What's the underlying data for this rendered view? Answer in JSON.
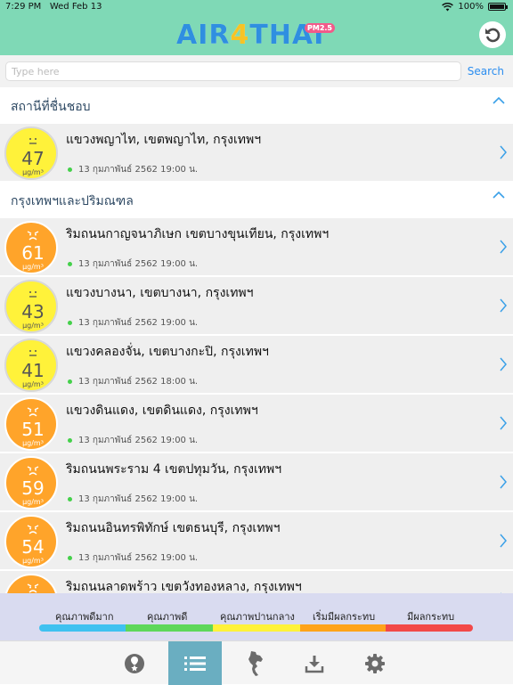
{
  "status_bar": {
    "time": "7:29 PM",
    "date": "Wed Feb 13",
    "battery": "100%",
    "battery_level": 1.0
  },
  "header": {
    "logo_air": "AIR",
    "logo_4": "4",
    "logo_thai": "THAI",
    "logo_badge": "PM2.5"
  },
  "search": {
    "placeholder": "Type here",
    "button": "Search"
  },
  "sections": [
    {
      "title": "สถานีที่ชื่นชอบ"
    },
    {
      "title": "กรุงเทพฯและปริมณฑล"
    }
  ],
  "unit": "μg/m³",
  "favorites": [
    {
      "name": "แขวงพญาไท, เขตพญาไท, กรุงเทพฯ",
      "value": "47",
      "time": "13 กุมภาพันธ์ 2562 19:00 น.",
      "level": "yellow"
    }
  ],
  "stations": [
    {
      "name": "ริมถนนกาญจนาภิเษก เขตบางขุนเทียน, กรุงเทพฯ",
      "value": "61",
      "time": "13 กุมภาพันธ์ 2562 19:00 น.",
      "level": "orange"
    },
    {
      "name": "แขวงบางนา, เขตบางนา, กรุงเทพฯ",
      "value": "43",
      "time": "13 กุมภาพันธ์ 2562 19:00 น.",
      "level": "yellow"
    },
    {
      "name": "แขวงคลองจั่น, เขตบางกะปิ, กรุงเทพฯ",
      "value": "41",
      "time": "13 กุมภาพันธ์ 2562 18:00 น.",
      "level": "yellow"
    },
    {
      "name": "แขวงดินแดง, เขตดินแดง, กรุงเทพฯ",
      "value": "51",
      "time": "13 กุมภาพันธ์ 2562 19:00 น.",
      "level": "orange"
    },
    {
      "name": "ริมถนนพระราม 4 เขตปทุมวัน, กรุงเทพฯ",
      "value": "59",
      "time": "13 กุมภาพันธ์ 2562 19:00 น.",
      "level": "orange"
    },
    {
      "name": "ริมถนนอินทรพิทักษ์ เขตธนบุรี, กรุงเทพฯ",
      "value": "54",
      "time": "13 กุมภาพันธ์ 2562 19:00 น.",
      "level": "orange"
    },
    {
      "name": "ริมถนนลาดพร้าว เขตวังทองหลาง, กรุงเทพฯ",
      "value": "",
      "time": "",
      "level": "orange"
    }
  ],
  "legend": [
    {
      "label": "คุณภาพดีมาก",
      "color": "#3fc1f0"
    },
    {
      "label": "คุณภาพดี",
      "color": "#5ed75a"
    },
    {
      "label": "คุณภาพปานกลาง",
      "color": "#fff23a"
    },
    {
      "label": "เริ่มมีผลกระทบ",
      "color": "#ffa31a"
    },
    {
      "label": "มีผลกระทบ",
      "color": "#f24848"
    }
  ],
  "colors": {
    "header": "#7fd9b6",
    "yellow": "#fff23a",
    "orange": "#ffa42a",
    "accent": "#2a8df0",
    "tab_active": "#6aaec1"
  },
  "tabs": [
    {
      "icon": "favorite-location-icon",
      "active": false
    },
    {
      "icon": "list-icon",
      "active": true
    },
    {
      "icon": "thailand-map-icon",
      "active": false
    },
    {
      "icon": "download-icon",
      "active": false
    },
    {
      "icon": "gear-icon",
      "active": false
    }
  ]
}
